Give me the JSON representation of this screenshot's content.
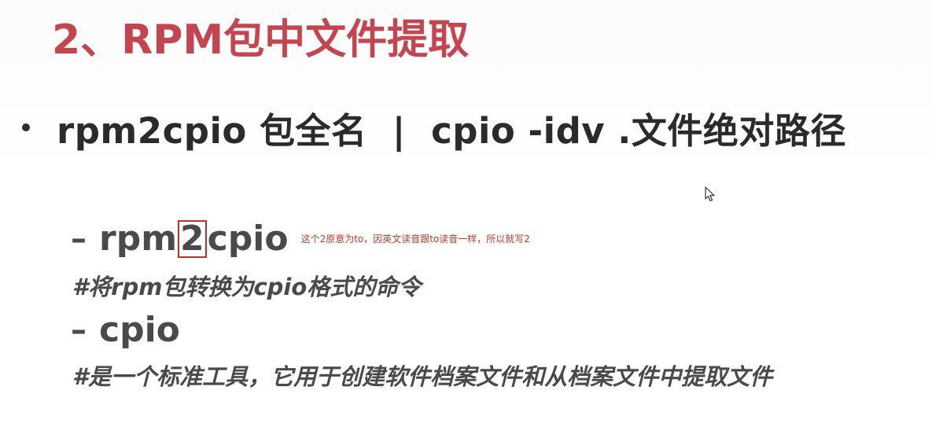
{
  "slide": {
    "title": "2、RPM包中文件提取",
    "bullet": {
      "text": "rpm2cpio 包全名  |  cpio -idv .文件绝对路径"
    },
    "items": [
      {
        "dash": "–",
        "prefix": "rpm",
        "highlight": "2",
        "suffix": "cpio",
        "annotation": "这个2原意为to，因英文读音跟to读音一样，所以就写2",
        "comment": "#将rpm包转换为cpio格式的命令"
      },
      {
        "dash": "–",
        "name": "cpio",
        "comment": "#是一个标准工具，它用于创建软件档案文件和从档案文件中提取文件"
      }
    ]
  },
  "colors": {
    "title": "#c2454f",
    "body_text": "#2b2b2b",
    "sub_text": "#4a4a4a",
    "highlight_border": "#c92a2a",
    "annotation": "#c0392b"
  },
  "icons": {
    "cursor": "mouse-pointer-icon"
  }
}
